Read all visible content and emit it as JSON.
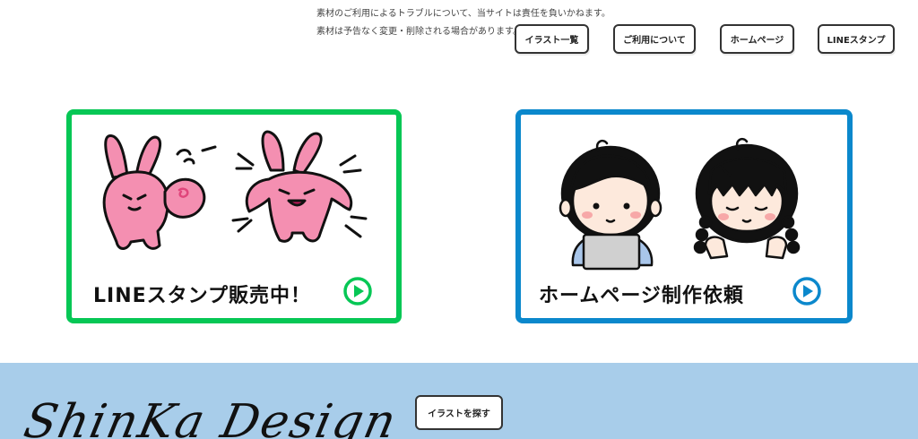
{
  "notice": {
    "line1": "素材のご利用によるトラブルについて、当サイトは責任を負いかねます。",
    "line2": "素材は予告なく変更・削除される場合があります。"
  },
  "nav": {
    "illust_list": "イラスト一覧",
    "usage": "ご利用について",
    "homepage": "ホームページ",
    "line_stamp": "LINEスタンプ"
  },
  "banners": {
    "line": {
      "title": "LINEスタンプ販売中！",
      "accent": "#06c755"
    },
    "web": {
      "title": "ホームページ制作依頼",
      "accent": "#0b88cc"
    }
  },
  "footer": {
    "logo": "ShinKa Design",
    "search_button": "イラストを探す",
    "background": "#a8cdea"
  }
}
